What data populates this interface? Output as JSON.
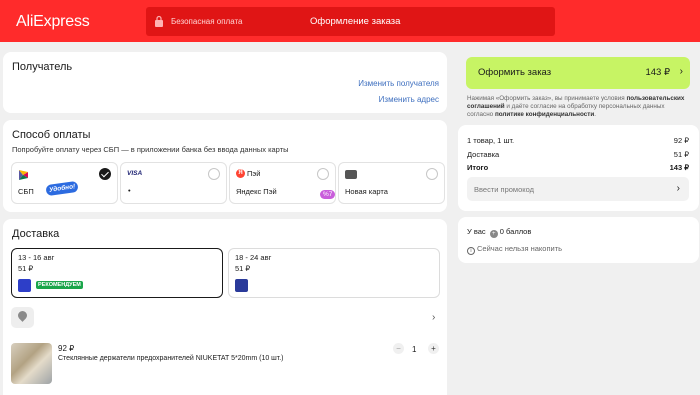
{
  "header": {
    "logo": "AliExpress",
    "secure_label": "Безопасная оплата",
    "title": "Оформление заказа"
  },
  "recipient": {
    "title": "Получатель",
    "change_recipient": "Изменить получателя",
    "change_address": "Изменить адрес"
  },
  "payment": {
    "title": "Способ оплаты",
    "subtitle": "Попробуйте оплату через СБП — в приложении банка без ввода данных карты",
    "options": [
      {
        "label": "СБП",
        "badge": "Удобно!",
        "selected": true
      },
      {
        "brand": "VISA",
        "label": "•",
        "selected": false
      },
      {
        "name": "Пэй",
        "label": "Яндекс Пэй",
        "badge": "%7",
        "selected": false
      },
      {
        "label": "Новая карта",
        "selected": false
      }
    ]
  },
  "delivery": {
    "title": "Доставка",
    "options": [
      {
        "dates": "13 - 16 авг",
        "price": "51 ₽",
        "badge": "РЕКОМЕНДУЕМ",
        "selected": true
      },
      {
        "dates": "18 - 24 авг",
        "price": "51 ₽",
        "selected": false
      }
    ],
    "product": {
      "price": "92 ₽",
      "name": "Стеклянные держатели предохранителей NIUKETAT 5*20mm (10 шт.)",
      "qty": "1",
      "minus": "−",
      "plus": "+"
    }
  },
  "order": {
    "button_label": "Оформить заказ",
    "total": "143 ₽",
    "terms_pre": "Нажимая «Оформить заказ», вы принимаете условия ",
    "terms_link1": "пользовательских соглашений",
    "terms_mid": " и даёте согласие на обработку персональных данных согласно ",
    "terms_link2": "политике конфиденциальности",
    "terms_end": "."
  },
  "summary": {
    "items_label": "1 товар, 1 шт.",
    "items_value": "92 ₽",
    "delivery_label": "Доставка",
    "delivery_value": "51 ₽",
    "total_label": "Итого",
    "total_value": "143 ₽",
    "promo_placeholder": "Ввести промокод"
  },
  "points": {
    "pre": "У вас",
    "value": "0 баллов",
    "note": "Сейчас нельзя накопить"
  },
  "colors": {
    "brand_red": "#ff2b2b",
    "order_green": "#c7f464",
    "link_blue": "#3e6fbf",
    "recommend_green": "#1aa54a"
  }
}
